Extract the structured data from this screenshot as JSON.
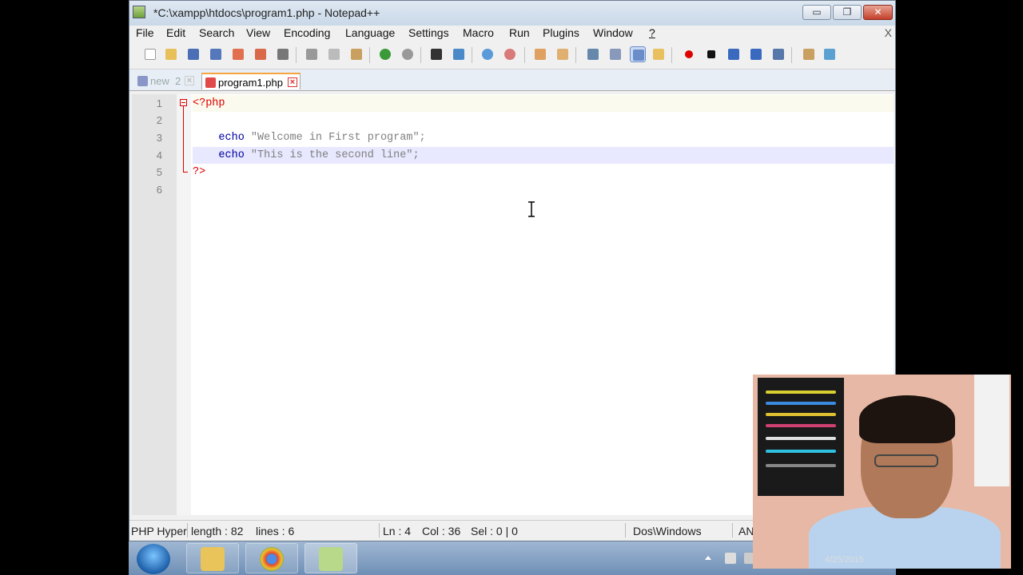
{
  "window": {
    "title": "*C:\\xampp\\htdocs\\program1.php - Notepad++",
    "controls": {
      "minimize": "▭",
      "maximize": "❐",
      "close": "✕"
    }
  },
  "menu": {
    "items": [
      "File",
      "Edit",
      "Search",
      "View",
      "Encoding",
      "Language",
      "Settings",
      "Macro",
      "Run",
      "Plugins",
      "Window",
      "?"
    ],
    "close_x": "X"
  },
  "tabs": [
    {
      "label": "new  2",
      "active": false
    },
    {
      "label": "program1.php",
      "active": true
    }
  ],
  "editor": {
    "line_numbers": [
      "1",
      "2",
      "3",
      "4",
      "5",
      "6"
    ],
    "lines": {
      "l1_tag": "<?php",
      "l3_kw": "echo",
      "l3_str": " \"Welcome in First program\";",
      "l4_kw": "echo",
      "l4_str": " \"This is the second line\";",
      "l5_tag": "?>"
    },
    "indent": "    ",
    "current_line": 4
  },
  "status": {
    "lang": "PHP Hyper",
    "length": "length : 82",
    "lines": "lines : 6",
    "ln": "Ln : 4",
    "col": "Col : 36",
    "sel": "Sel : 0 | 0",
    "eol": "Dos\\Windows",
    "encoding": "AN"
  },
  "taskbar": {
    "apps": [
      "file-explorer",
      "chrome",
      "notepad-plus-plus"
    ],
    "date_partial": "4/25/2015"
  },
  "colors": {
    "php_tag": "#e00000",
    "keyword": "#0000a0",
    "string": "#808080",
    "current_line_bg": "#e8e8ff"
  }
}
